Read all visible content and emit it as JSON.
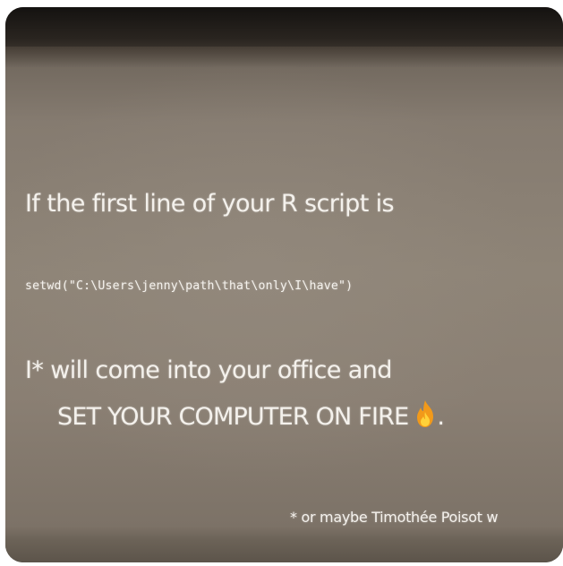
{
  "slide": {
    "line1": "If the first line of your R script is",
    "code": "setwd(\"C:\\Users\\jenny\\path\\that\\only\\I\\have\")",
    "line3": "I* will come into your office and",
    "line4": "SET YOUR COMPUTER ON FIRE",
    "line4_end": ".",
    "footnote": "* or maybe Timothée Poisot w",
    "fire_icon": "fire-emoji-icon"
  },
  "colors": {
    "text": "#f4f1ec",
    "screen": "#8e8477",
    "flame_outer": "#f29a1a",
    "flame_inner": "#ffd23a"
  }
}
